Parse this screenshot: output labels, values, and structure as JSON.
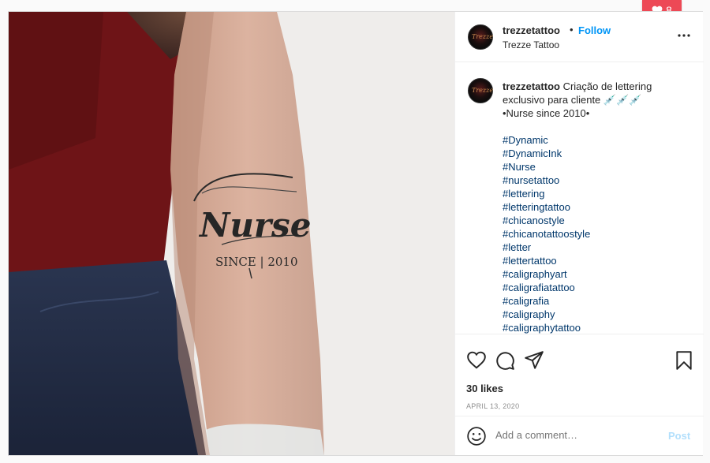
{
  "notification": {
    "likes_count": "8"
  },
  "post": {
    "author_username": "trezzetattoo",
    "separator": "•",
    "follow_label": "Follow",
    "subtitle": "Trezze Tattoo",
    "caption": {
      "username": "trezzetattoo",
      "text": "Criação de lettering exclusivo para cliente 💉💉💉",
      "line2": "•Nurse since 2010•",
      "hashtags": [
        "#Dynamic",
        "#DynamicInk",
        "#Nurse",
        "#nursetattoo",
        "#lettering",
        "#letteringtattoo",
        "#chicanostyle",
        "#chicanotattoostyle",
        "#letter",
        "#lettertattoo",
        "#caligraphyart",
        "#caligrafiatattoo",
        "#caligrafia",
        "#caligraphy",
        "#caligraphytattoo"
      ]
    },
    "likes": "30 likes",
    "date": "APRIL 13, 2020",
    "comment_placeholder": "Add a comment…",
    "post_label": "Post",
    "tattoo": {
      "word": "Nurse",
      "since": "SINCE | 2010"
    }
  },
  "icons": [
    "avatar-logo",
    "more-icon",
    "heart-icon",
    "comment-icon",
    "share-icon",
    "bookmark-icon",
    "emoji-icon"
  ]
}
